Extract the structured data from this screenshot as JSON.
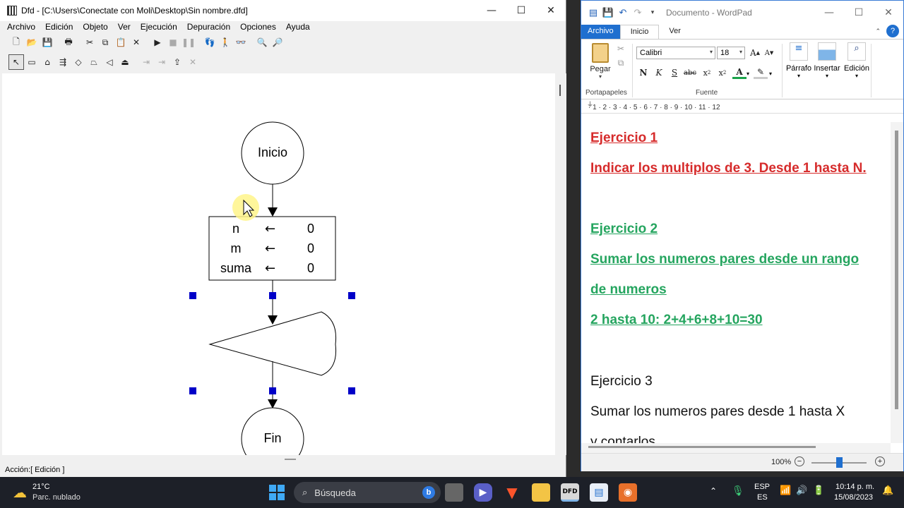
{
  "dfd": {
    "title": "Dfd - [C:\\Users\\Conectate con Moli\\Desktop\\Sin nombre.dfd]",
    "menu": [
      "Archivo",
      "Edición",
      "Objeto",
      "Ver",
      "Ejecución",
      "Depuración",
      "Opciones",
      "Ayuda"
    ],
    "status": "Acción:[ Edición ]",
    "flow": {
      "start": "Inicio",
      "assignments": [
        {
          "var": "n",
          "arrow": "←",
          "value": "0"
        },
        {
          "var": "m",
          "arrow": "←",
          "value": "0"
        },
        {
          "var": "suma",
          "arrow": "←",
          "value": "0"
        }
      ],
      "end": "Fin"
    }
  },
  "wordpad": {
    "title": "Documento - WordPad",
    "tabs": {
      "file": "Archivo",
      "home": "Inicio",
      "view": "Ver"
    },
    "clipboard": {
      "paste": "Pegar",
      "group": "Portapapeles"
    },
    "font": {
      "family": "Calibri",
      "size": "18",
      "group": "Fuente"
    },
    "groups": {
      "paragraph": "Párrafo",
      "insert": "Insertar",
      "edit": "Edición"
    },
    "ruler": "· 1 · 2 · 3 · 4 · 5 · 6 · 7 · 8 · 9 · 10 · 11 · 12",
    "doc": {
      "ex1_title": "Ejercicio 1",
      "ex1_text": "Indicar los multiplos de 3. Desde 1 hasta N.",
      "ex2_title": "Ejercicio 2",
      "ex2_text1": "Sumar los numeros pares desde un rango",
      "ex2_text2": "de numeros",
      "ex2_text3": "2 hasta 10: 2+4+6+8+10=30",
      "ex3_title": "Ejercicio 3",
      "ex3_text": "Sumar los numeros pares desde 1 hasta X",
      "ex3_cut": "y contarlos"
    },
    "zoom": "100%"
  },
  "taskbar": {
    "weather_temp": "21°C",
    "weather_desc": "Parc. nublado",
    "search": "Búsqueda",
    "lang1": "ESP",
    "lang2": "ES",
    "time": "10:14 p. m.",
    "date": "15/08/2023"
  }
}
